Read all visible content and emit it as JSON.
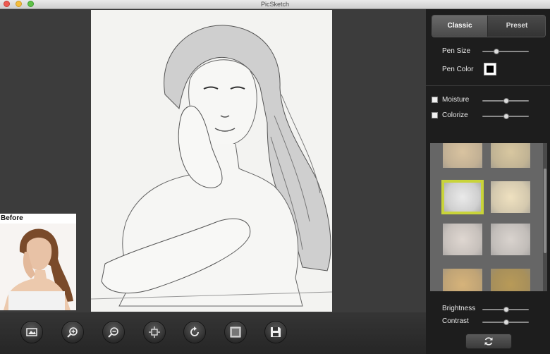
{
  "window": {
    "title": "PicSketch"
  },
  "preview": {
    "before_label": "Before"
  },
  "toolbar": {
    "buttons": [
      {
        "name": "open-image-button",
        "icon": "image-icon"
      },
      {
        "name": "zoom-in-button",
        "icon": "zoom-in-icon"
      },
      {
        "name": "zoom-out-button",
        "icon": "zoom-out-icon"
      },
      {
        "name": "fit-to-window-button",
        "icon": "fit-icon"
      },
      {
        "name": "rotate-button",
        "icon": "rotate-icon"
      },
      {
        "name": "compare-button",
        "icon": "frame-icon"
      },
      {
        "name": "save-button",
        "icon": "save-icon"
      }
    ]
  },
  "panel": {
    "tabs": {
      "classic": "Classic",
      "preset": "Preset",
      "active": "classic"
    },
    "pen_size": {
      "label": "Pen Size",
      "value": 0.28
    },
    "pen_color": {
      "label": "Pen Color",
      "color": "#000000"
    },
    "moisture": {
      "label": "Moisture",
      "checked": false,
      "value": 0.52
    },
    "colorize": {
      "label": "Colorize",
      "checked": false,
      "value": 0.52
    },
    "textures": [
      {
        "color": "#d9c3a0",
        "selected": false
      },
      {
        "color": "#d8c7a0",
        "selected": false
      },
      {
        "color": "#eaeaea",
        "selected": true
      },
      {
        "color": "#efe1c0",
        "selected": false
      },
      {
        "color": "#dfd7d1",
        "selected": false
      },
      {
        "color": "#d9d3ce",
        "selected": false
      },
      {
        "color": "#d6b37a",
        "selected": false
      },
      {
        "color": "#b89a58",
        "selected": false
      }
    ],
    "brightness": {
      "label": "Brightness",
      "value": 0.52
    },
    "contrast": {
      "label": "Contrast",
      "value": 0.52
    }
  },
  "colors": {
    "selection_border": "#c9d43a"
  }
}
